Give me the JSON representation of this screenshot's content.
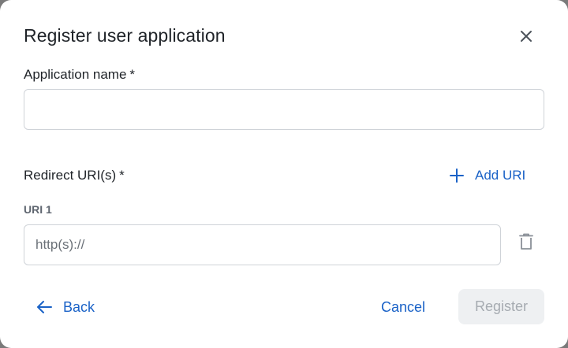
{
  "dialog": {
    "title": "Register user application",
    "close_icon": "close-icon"
  },
  "application_name": {
    "label": "Application name",
    "required_marker": "*",
    "value": "",
    "placeholder": ""
  },
  "redirect_uris": {
    "label": "Redirect URI(s)",
    "required_marker": "*",
    "add_label": "Add URI",
    "add_icon": "plus-icon",
    "items": [
      {
        "label": "URI 1",
        "value": "",
        "placeholder": "http(s)://",
        "delete_icon": "trash-icon"
      }
    ]
  },
  "footer": {
    "back_label": "Back",
    "back_icon": "arrow-left-icon",
    "cancel_label": "Cancel",
    "register_label": "Register",
    "register_disabled": true
  },
  "colors": {
    "accent": "#1a62c7",
    "text": "#1f2328",
    "muted": "#5f6670",
    "disabled_bg": "#eef0f2",
    "disabled_text": "#a6abb1"
  }
}
